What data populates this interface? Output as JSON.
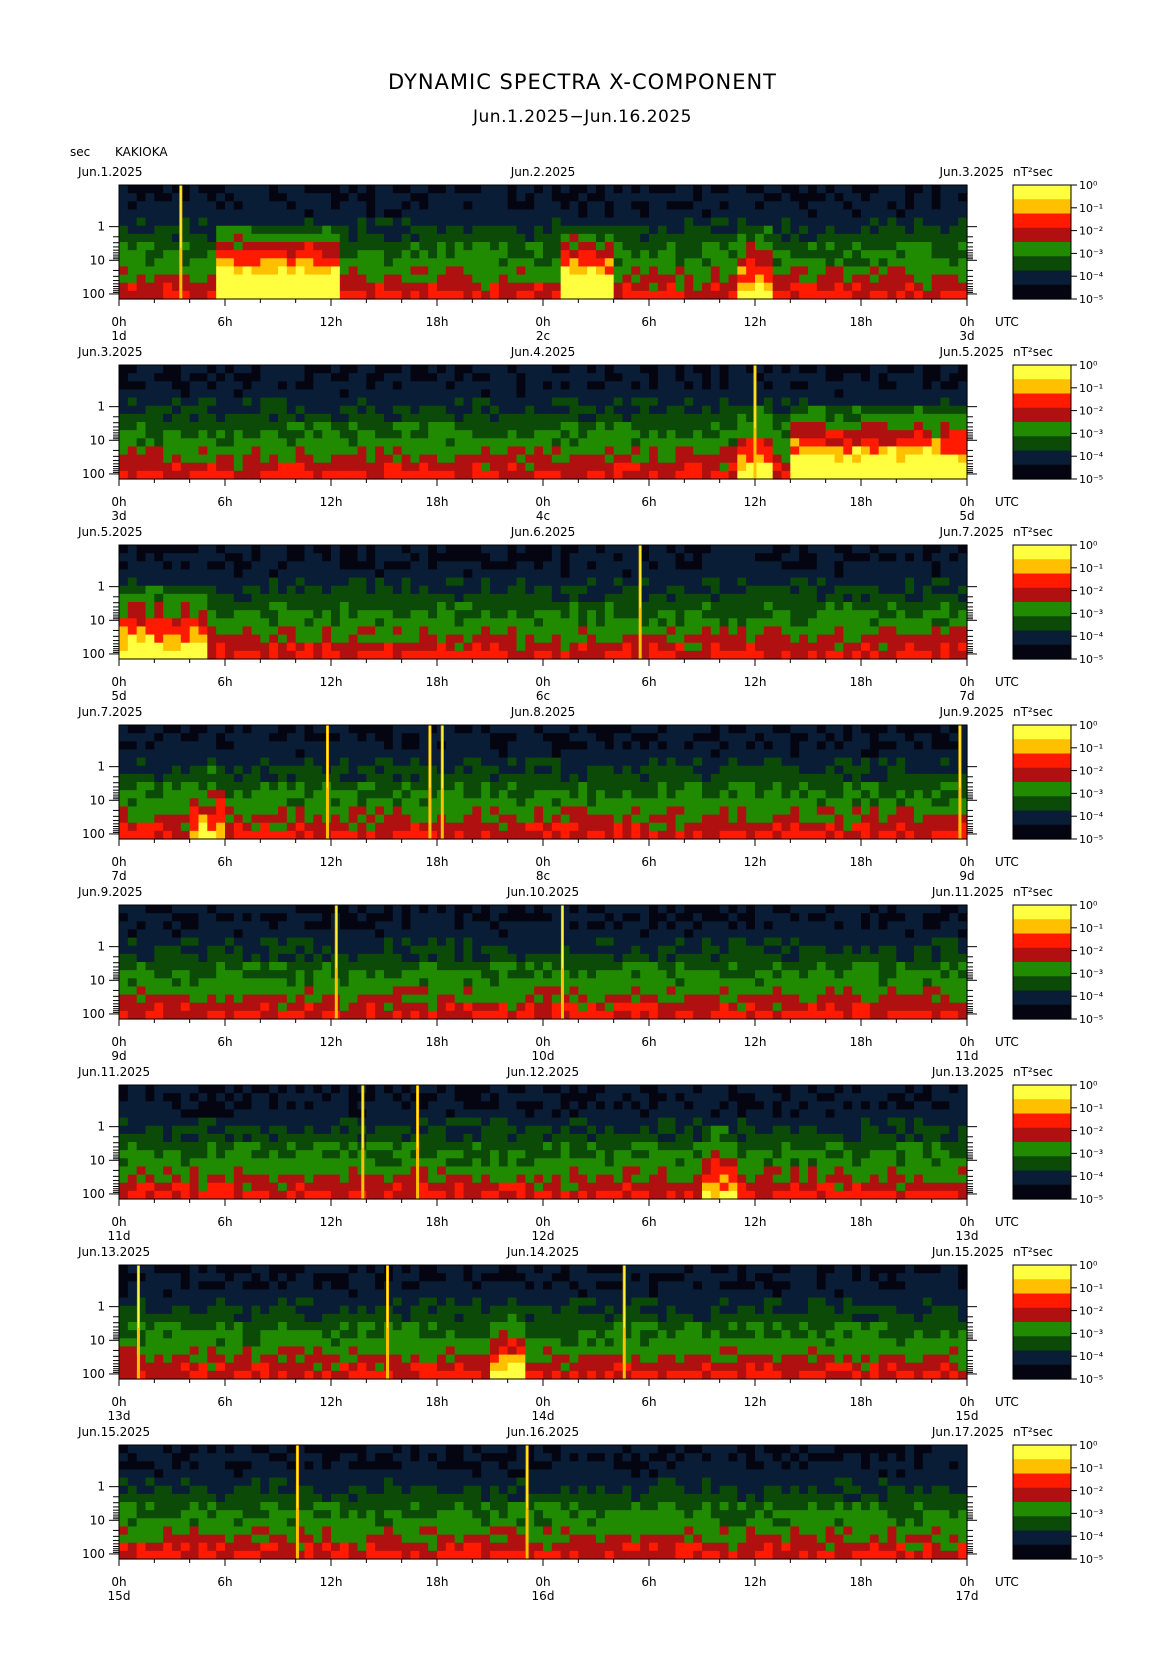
{
  "title": "DYNAMIC SPECTRA X-COMPONENT",
  "subtitle": "Jun.1.2025−Jun.16.2025",
  "station": {
    "unit_label": "sec",
    "name": "KAKIOKA"
  },
  "colorbar": {
    "unit": "nT²sec",
    "ticks": [
      "10⁰",
      "10⁻¹",
      "10⁻²",
      "10⁻³",
      "10⁻⁴",
      "10⁻⁵"
    ],
    "colors": [
      "#ffff40",
      "#ffc000",
      "#ff1a00",
      "#b01010",
      "#208a00",
      "#0c4a08",
      "#0a1d36",
      "#050512"
    ]
  },
  "period_axis": {
    "ticks": [
      "1",
      "10",
      "100"
    ],
    "unit": "sec"
  },
  "time_axis": {
    "ticks": [
      "0h",
      "6h",
      "12h",
      "18h",
      "0h",
      "6h",
      "12h",
      "18h",
      "0h"
    ],
    "unit": "UTC"
  },
  "chart_data": [
    {
      "type": "heatmap",
      "panel": 1,
      "date_left": "Jun.1.2025",
      "date_mid": "Jun.2.2025",
      "date_right": "Jun.3.2025",
      "day_start": "1d",
      "day_mid": "2c",
      "day_end": "3d",
      "spikes": [
        3.5
      ],
      "bursts": [
        {
          "start": 5.5,
          "end": 12.5,
          "level": 0.95
        },
        {
          "start": 25,
          "end": 28,
          "level": 0.85
        },
        {
          "start": 35,
          "end": 37,
          "level": 0.55
        }
      ]
    },
    {
      "type": "heatmap",
      "panel": 2,
      "date_left": "Jun.3.2025",
      "date_mid": "Jun.4.2025",
      "date_right": "Jun.5.2025",
      "day_start": "3d",
      "day_mid": "4c",
      "day_end": "5d",
      "spikes": [
        36
      ],
      "bursts": [
        {
          "start": 38,
          "end": 48,
          "level": 0.75
        },
        {
          "start": 35,
          "end": 37,
          "level": 0.5
        }
      ]
    },
    {
      "type": "heatmap",
      "panel": 3,
      "date_left": "Jun.5.2025",
      "date_mid": "Jun.6.2025",
      "date_right": "Jun.7.2025",
      "day_start": "5d",
      "day_mid": "6c",
      "day_end": "7d",
      "spikes": [
        29.5
      ],
      "bursts": [
        {
          "start": 0,
          "end": 5,
          "level": 0.6
        }
      ]
    },
    {
      "type": "heatmap",
      "panel": 4,
      "date_left": "Jun.7.2025",
      "date_mid": "Jun.8.2025",
      "date_right": "Jun.9.2025",
      "day_start": "7d",
      "day_mid": "8c",
      "day_end": "9d",
      "spikes": [
        11.8,
        17.6,
        18.3,
        47.6
      ],
      "bursts": [
        {
          "start": 4,
          "end": 6,
          "level": 0.4
        }
      ]
    },
    {
      "type": "heatmap",
      "panel": 5,
      "date_left": "Jun.9.2025",
      "date_mid": "Jun.10.2025",
      "date_right": "Jun.11.2025",
      "day_start": "9d",
      "day_mid": "10d",
      "day_end": "11d",
      "spikes": [
        12.3,
        25.1
      ],
      "bursts": []
    },
    {
      "type": "heatmap",
      "panel": 6,
      "date_left": "Jun.11.2025",
      "date_mid": "Jun.12.2025",
      "date_right": "Jun.13.2025",
      "day_start": "11d",
      "day_mid": "12d",
      "day_end": "13d",
      "spikes": [
        13.8,
        16.9
      ],
      "bursts": [
        {
          "start": 33,
          "end": 35,
          "level": 0.4
        }
      ]
    },
    {
      "type": "heatmap",
      "panel": 7,
      "date_left": "Jun.13.2025",
      "date_mid": "Jun.14.2025",
      "date_right": "Jun.15.2025",
      "day_start": "13d",
      "day_mid": "14d",
      "day_end": "15d",
      "spikes": [
        1.1,
        15.2,
        28.6
      ],
      "bursts": [
        {
          "start": 21,
          "end": 23,
          "level": 0.45
        }
      ]
    },
    {
      "type": "heatmap",
      "panel": 8,
      "date_left": "Jun.15.2025",
      "date_mid": "Jun.16.2025",
      "date_right": "Jun.17.2025",
      "day_start": "15d",
      "day_mid": "16d",
      "day_end": "17d",
      "spikes": [
        10.1,
        23.1
      ],
      "bursts": []
    }
  ]
}
